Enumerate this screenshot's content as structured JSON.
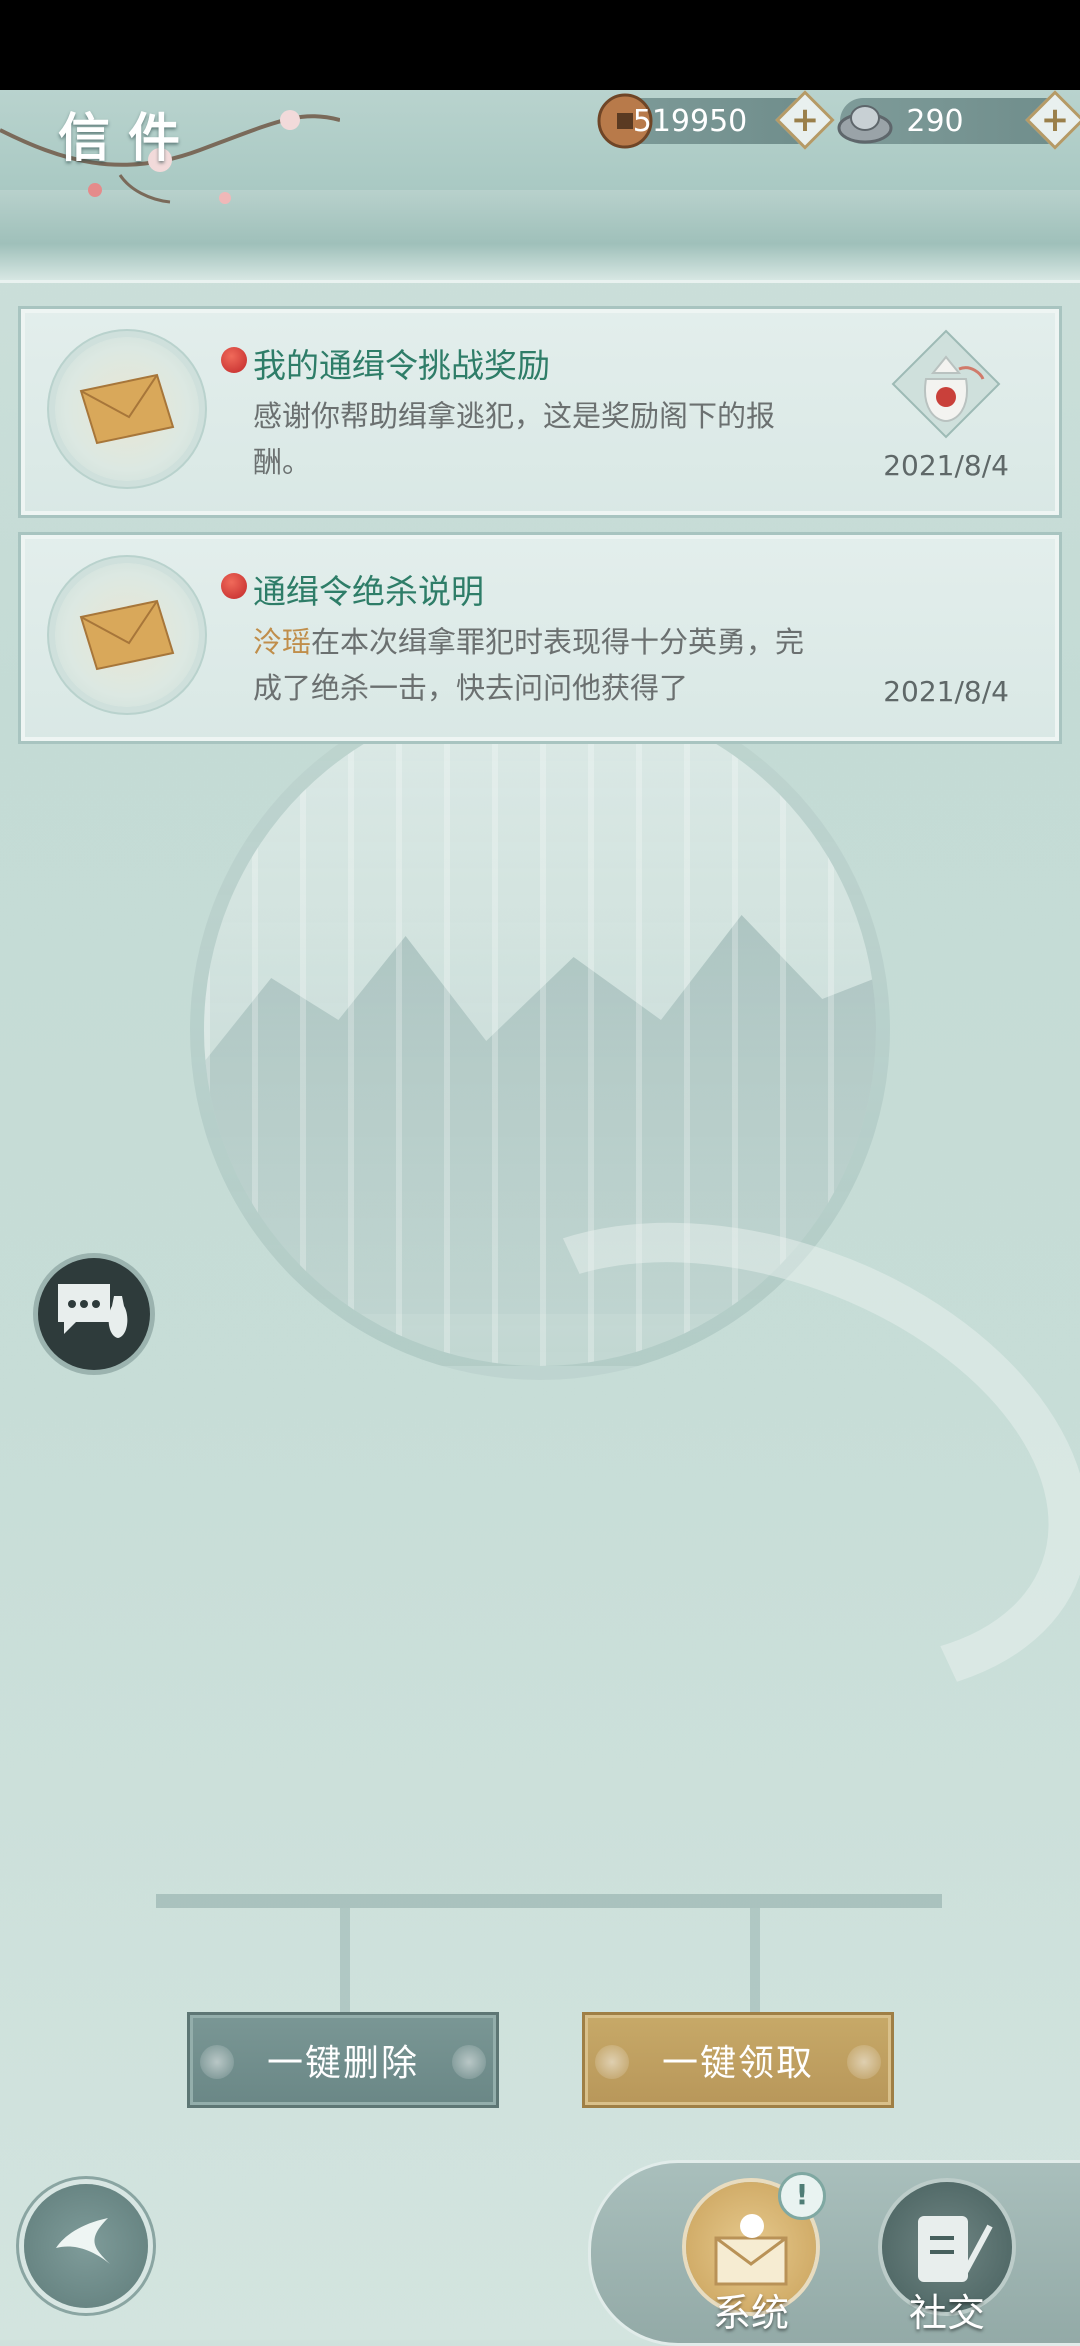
{
  "header": {
    "title": "信件",
    "coins": "519950",
    "silver": "290",
    "plus_symbol": "+"
  },
  "mails": [
    {
      "title": "我的通缉令挑战奖励",
      "body": "感谢你帮助缉拿逃犯，这是奖励阁下的报酬。",
      "date": "2021/8/4",
      "attachment_icon": "reward-bag-icon"
    },
    {
      "title": "通缉令绝杀说明",
      "body_highlight": "泠瑶",
      "body": "在本次缉拿罪犯时表现得十分英勇，完成了绝杀一击，快去问问他获得了",
      "date": "2021/8/4"
    }
  ],
  "actions": {
    "delete_all": "一键删除",
    "claim_all": "一键领取"
  },
  "tabs": {
    "system": "系统",
    "social": "社交",
    "badge": "!"
  },
  "colors": {
    "accent_green": "#2e7d68",
    "gold": "#b8975a",
    "unread_dot": "#c1282a"
  }
}
